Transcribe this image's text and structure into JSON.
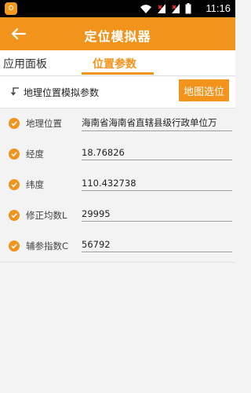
{
  "status_bar": {
    "time": "11:16"
  },
  "app_bar": {
    "title": "定位模拟器"
  },
  "tabs": [
    {
      "label": "应用面板",
      "selected": false
    },
    {
      "label": "位置参数",
      "selected": true
    }
  ],
  "section": {
    "title": "地理位置模拟参数",
    "map_button_label": "地图选位"
  },
  "params": [
    {
      "label": "地理位置",
      "value": "海南省海南省直辖县级行政单位万"
    },
    {
      "label": "经度",
      "value": "18.76826"
    },
    {
      "label": "纬度",
      "value": "110.432738"
    },
    {
      "label": "修正均数L",
      "value": "29995"
    },
    {
      "label": "辅参指数C",
      "value": "56792"
    }
  ],
  "colors": {
    "accent": "#f2931c",
    "background": "#f3f3f3"
  }
}
